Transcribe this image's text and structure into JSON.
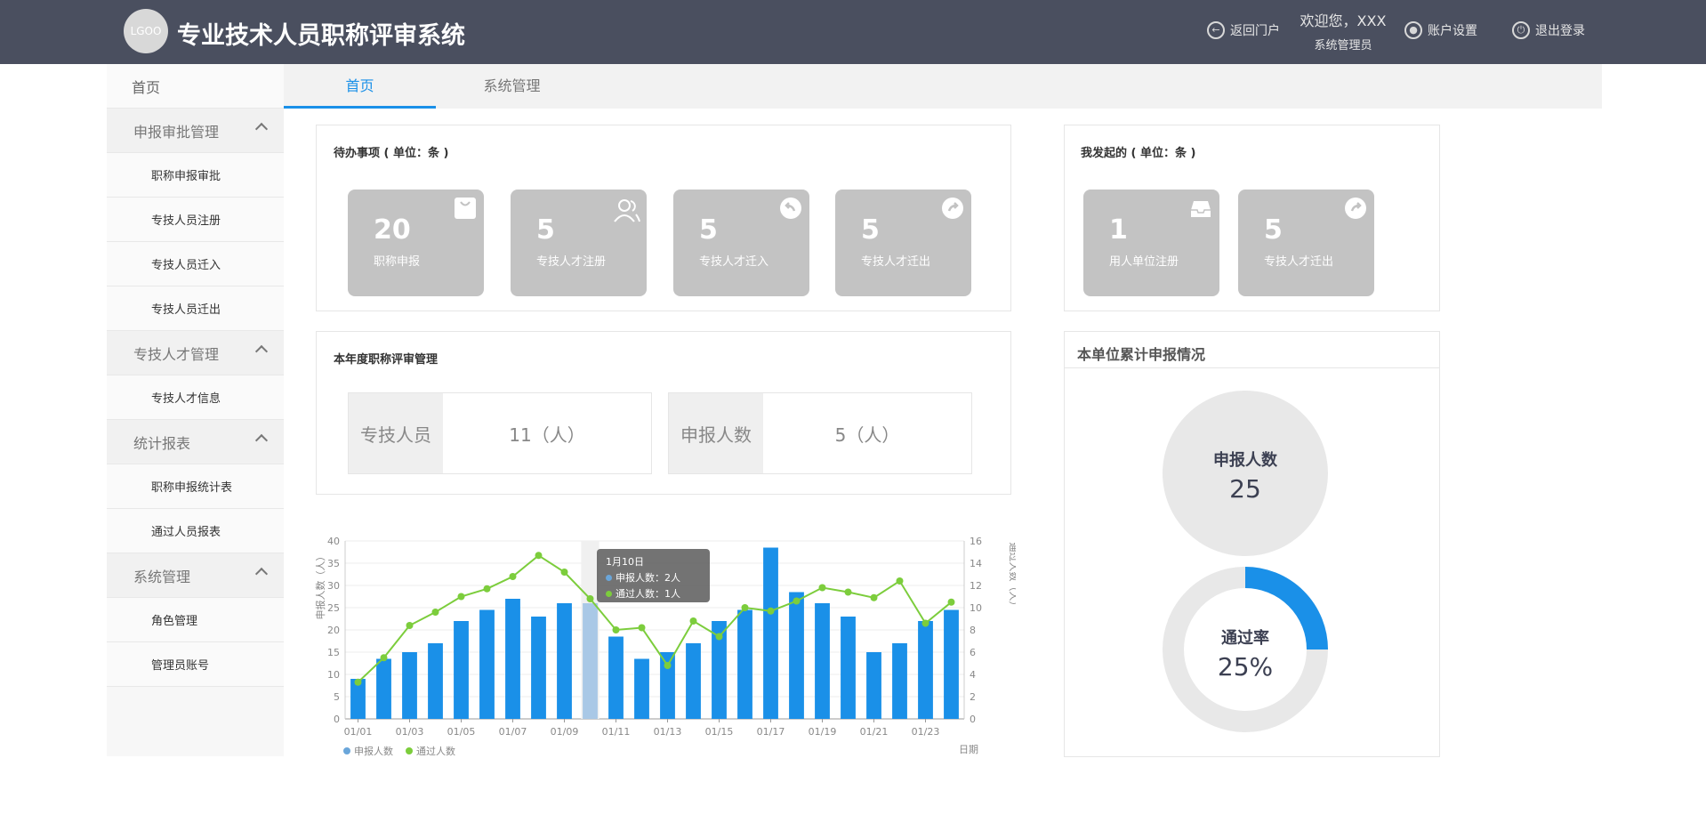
{
  "header": {
    "logo_text": "LGOO",
    "title": "专业技术人员职称评审系统",
    "back_portal": "返回门户",
    "welcome": "欢迎您，XXX",
    "role": "系统管理员",
    "account_settings": "账户设置",
    "logout": "退出登录"
  },
  "sidebar": {
    "home": "首页",
    "groups": [
      {
        "label": "申报审批管理",
        "items": [
          "职称申报审批",
          "专技人员注册",
          "专技人员迁入",
          "专技人员迁出"
        ]
      },
      {
        "label": "专技人才管理",
        "items": [
          "专技人才信息"
        ]
      },
      {
        "label": "统计报表",
        "items": [
          "职称申报统计表",
          "通过人员报表"
        ]
      },
      {
        "label": "系统管理",
        "items": [
          "角色管理",
          "管理员账号"
        ]
      }
    ]
  },
  "tabs": [
    "首页",
    "系统管理"
  ],
  "todo": {
    "title": "待办事项 ( 单位：条 )",
    "cards": [
      {
        "num": "20",
        "label": "职称申报",
        "icon": "bag-icon"
      },
      {
        "num": "5",
        "label": "专技人才注册",
        "icon": "users-icon"
      },
      {
        "num": "5",
        "label": "专技人才迁入",
        "icon": "arrow-in-icon"
      },
      {
        "num": "5",
        "label": "专技人才迁出",
        "icon": "arrow-out-icon"
      }
    ]
  },
  "mine": {
    "title": "我发起的 ( 单位：条 )",
    "cards": [
      {
        "num": "1",
        "label": "用人单位注册",
        "icon": "inbox-icon"
      },
      {
        "num": "5",
        "label": "专技人才迁出",
        "icon": "arrow-out-icon"
      }
    ]
  },
  "annual": {
    "title": "本年度职称评审管理",
    "staff_label": "专技人员",
    "staff_value": "11（人）",
    "applicants_label": "申报人数",
    "applicants_value": "5（人）"
  },
  "summary": {
    "title": "本单位累计申报情况",
    "applicants_label": "申报人数",
    "applicants_value": "25",
    "pass_label": "通过率",
    "pass_value": "25%",
    "pass_rate": 0.25,
    "ring_color": "#1a90e8"
  },
  "tooltip": {
    "date": "1月10日",
    "line1": "申报人数：2人",
    "line2": "通过人数：1人"
  },
  "chart_data": {
    "type": "bar",
    "x": [
      "01/01",
      "01/02",
      "01/03",
      "01/04",
      "01/05",
      "01/06",
      "01/07",
      "01/08",
      "01/09",
      "01/10",
      "01/11",
      "01/12",
      "01/13",
      "01/14",
      "01/15",
      "01/16",
      "01/17",
      "01/18",
      "01/19",
      "01/20",
      "01/21",
      "01/22",
      "01/23"
    ],
    "x_tick_labels": [
      "01/01",
      "01/03",
      "01/05",
      "01/07",
      "01/09",
      "01/11",
      "01/13",
      "01/15",
      "01/17",
      "01/19",
      "01/21",
      "01/23"
    ],
    "series": [
      {
        "name": "申报人数",
        "type": "bar",
        "axis": "left",
        "color": "#1a90e8",
        "values": [
          9,
          13.5,
          15,
          17,
          22,
          24.5,
          27,
          23,
          26,
          26,
          18.5,
          13.5,
          15,
          17,
          22,
          24.5,
          38.5,
          28.5,
          26,
          23,
          15,
          17,
          22,
          24.5
        ]
      },
      {
        "name": "通过人数",
        "type": "line",
        "axis": "right",
        "color": "#7ccd3c",
        "values": [
          3.3,
          5.5,
          8.4,
          9.6,
          11,
          11.7,
          12.8,
          14.7,
          13.2,
          10.8,
          8,
          8.2,
          4.8,
          8.8,
          7.4,
          10,
          9.7,
          10.6,
          11.8,
          11.4,
          10.9,
          12.4,
          8.6,
          10.5
        ]
      }
    ],
    "ylabel_left": "申报人数（人）",
    "ylabel_right": "通过人数（人）",
    "xlabel": "日期",
    "ylim_left": [
      0,
      40
    ],
    "ylim_right": [
      0,
      16
    ],
    "yticks_left": [
      0,
      5,
      10,
      15,
      20,
      25,
      30,
      35,
      40
    ],
    "yticks_right": [
      0,
      2,
      4,
      6,
      8,
      10,
      12,
      14,
      16
    ],
    "highlight_index": 9,
    "highlight_color": "#a9c8e6",
    "legend_position": "bottom-left"
  }
}
